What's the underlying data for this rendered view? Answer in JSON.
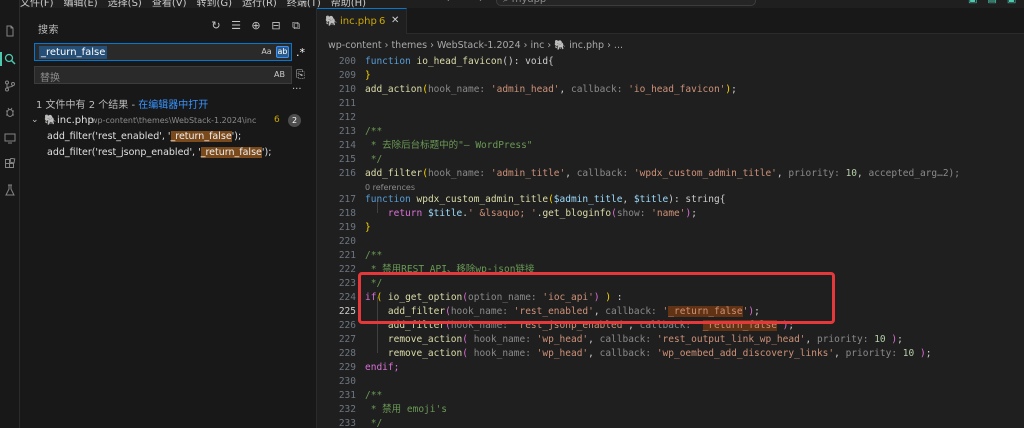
{
  "menubar": {
    "items": [
      "文件(F)",
      "编辑(E)",
      "选择(S)",
      "查看(V)",
      "转到(G)",
      "运行(R)",
      "终端(T)",
      "帮助(H)"
    ],
    "nav_back": "←",
    "nav_forward": "→",
    "command_center": "myapp"
  },
  "sidebar": {
    "title": "搜索",
    "search": {
      "value": "_return_false",
      "opt_case": "Aa",
      "opt_word": "ab",
      "opt_regex": ".*"
    },
    "replace": {
      "placeholder": "替换",
      "opt_preserve": "AB"
    },
    "summary": {
      "text": "1 文件中有 2 个结果 - ",
      "link": "在编辑器中打开"
    },
    "file": {
      "name": "inc.php",
      "path": "wp-content\\themes\\WebStack-1.2024\\inc",
      "problems": "6",
      "matches": "2"
    },
    "results": [
      {
        "pre": "add_filter('rest_enabled', '",
        "match": "_return_false",
        "post": "');"
      },
      {
        "pre": "add_filter('rest_jsonp_enabled', '",
        "match": "_return_false",
        "post": "');"
      }
    ]
  },
  "editor": {
    "tab": {
      "name": "inc.php",
      "problems": "6"
    },
    "breadcrumb": [
      "wp-content",
      "themes",
      "WebStack-1.2024",
      "inc",
      "inc.php",
      "..."
    ],
    "line_numbers": [
      "200",
      "209",
      "210",
      "211",
      "212",
      "213",
      "214",
      "215",
      "216",
      "",
      "217",
      "218",
      "219",
      "220",
      "221",
      "222",
      "223",
      "224",
      "225",
      "226",
      "227",
      "228",
      "229",
      "230",
      "231",
      "232",
      "233",
      ""
    ],
    "references_label": "0 references",
    "code": {
      "l200_fn": "io_head_favicon",
      "l200_rest": "(): void{",
      "l210_fn": "add_action",
      "l210_h1": "hook_name:",
      "l210_s1": "'admin_head'",
      "l210_h2": "callback:",
      "l210_s2": "'io_head_favicon'",
      "l214": " * 去除后台标题中的\"— WordPress\"",
      "l216_fn": "add_filter",
      "l216_h1": "hook_name:",
      "l216_s1": "'admin_title'",
      "l216_h2": "callback:",
      "l216_s2": "'wpdx_custom_admin_title'",
      "l216_h3": "priority:",
      "l216_n1": "10",
      "l216_tail": "accepted_arg…2);",
      "l217_fn": "wpdx_custom_admin_title",
      "l217_v1": "$admin_title",
      "l217_v2": "$title",
      "l217_tail": "): string{",
      "l218_kw": "return",
      "l218_v": "$title",
      "l218_s1": "'",
      "l218_ent": "&lsaquo;",
      "l218_s2": "'",
      "l218_fn": "get_bloginfo",
      "l218_h": "show:",
      "l218_s3": "'name'",
      "l222": " * 禁用REST API、移除wp-json链接",
      "l224_fn": "io_get_option",
      "l224_h": "option_name:",
      "l224_s": "'ioc_api'",
      "l225_fn": "add_filter",
      "l225_h1": "hook_name:",
      "l225_s1": "'rest_enabled'",
      "l225_h2": "callback:",
      "l225_m": "_return_false",
      "l226_fn": "add_filter",
      "l226_h1": "hook_name:",
      "l226_s1": "'rest_jsonp_enabled'",
      "l226_h2": "callback:",
      "l226_m": "_return_false",
      "l227_fn": "remove_action",
      "l227_h1": "hook_name:",
      "l227_s1": "'wp_head'",
      "l227_h2": "callback:",
      "l227_s2": "'rest_output_link_wp_head'",
      "l227_h3": "priority:",
      "l227_n": "10",
      "l228_fn": "remove_action",
      "l228_h1": "hook_name:",
      "l228_s1": "'wp_head'",
      "l228_h2": "callback:",
      "l228_s2": "'wp_oembed_add_discovery_links'",
      "l228_h3": "priority:",
      "l228_n": "10",
      "l229": "endif;",
      "l232": " * 禁用 emoji's"
    }
  },
  "colors": {
    "accent": "#0078d4",
    "annotation": "#e5383b",
    "match_bg": "#613214",
    "warning": "#cca700"
  }
}
